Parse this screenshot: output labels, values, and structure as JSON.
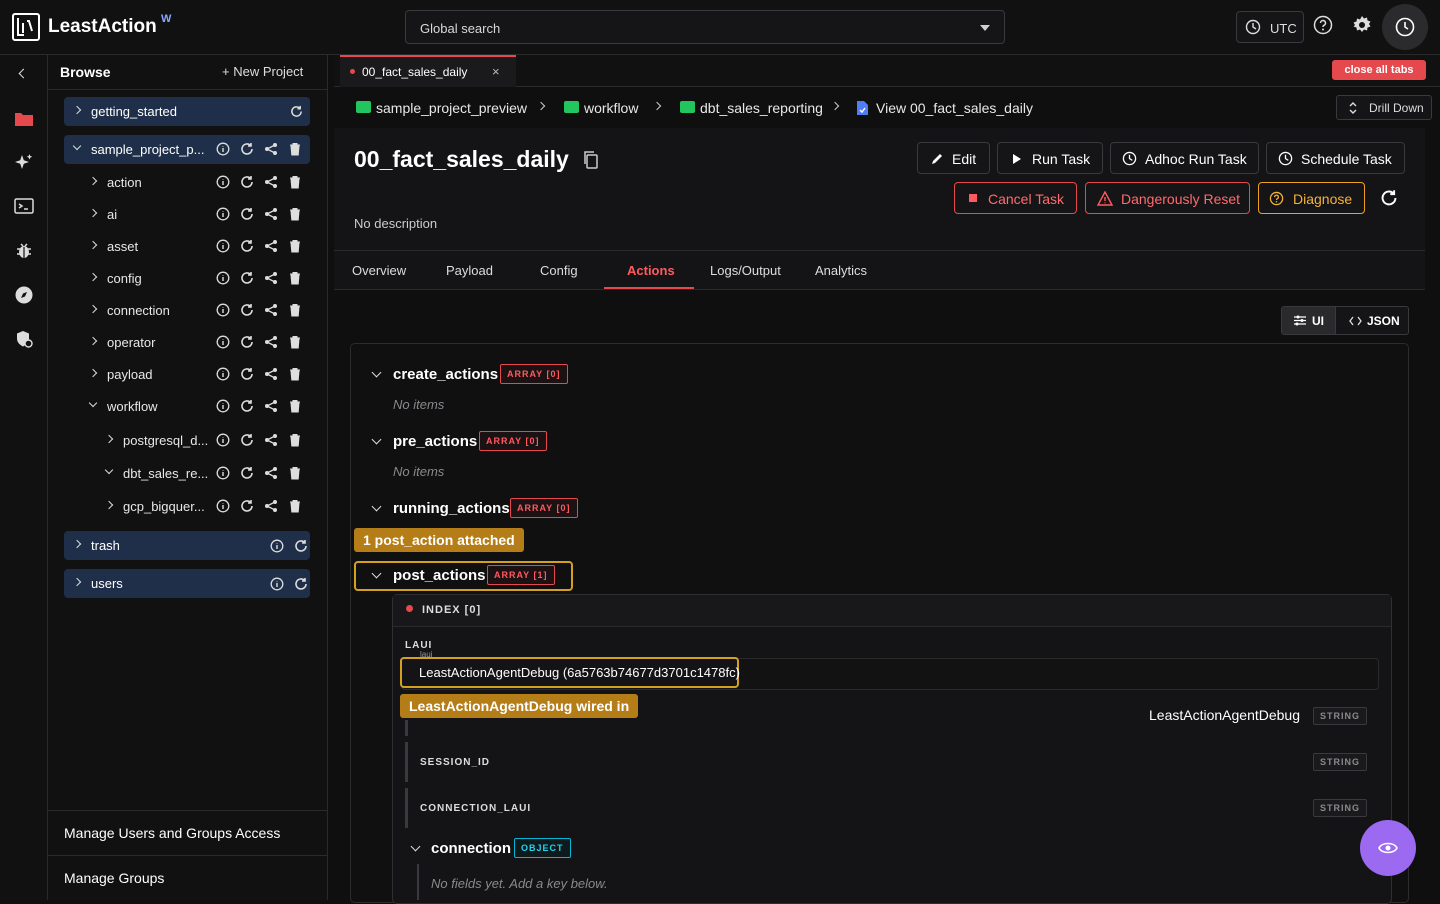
{
  "app": {
    "name": "LeastAction",
    "superscript": "W"
  },
  "topbar": {
    "search_placeholder": "Global search",
    "timezone": "UTC"
  },
  "sidebar": {
    "title": "Browse",
    "new_project": "+ New Project",
    "roots": [
      "getting_started",
      "sample_project_p...",
      "trash",
      "users"
    ],
    "children": [
      "action",
      "ai",
      "asset",
      "config",
      "connection",
      "operator",
      "payload",
      "workflow"
    ],
    "workflow_children": [
      "postgresql_d...",
      "dbt_sales_re...",
      "gcp_bigquer..."
    ],
    "manage_users": "Manage Users and Groups Access",
    "manage_groups": "Manage Groups"
  },
  "tabs": {
    "active": "00_fact_sales_daily",
    "close": "×",
    "close_all": "close all tabs"
  },
  "breadcrumb": [
    "sample_project_preview",
    "workflow",
    "dbt_sales_reporting",
    "View 00_fact_sales_daily"
  ],
  "drill_down": "Drill Down",
  "task": {
    "title": "00_fact_sales_daily",
    "description": "No description"
  },
  "buttons": {
    "edit": "Edit",
    "run": "Run Task",
    "adhoc": "Adhoc Run Task",
    "schedule": "Schedule Task",
    "cancel": "Cancel Task",
    "reset": "Dangerously Reset",
    "diagnose": "Diagnose"
  },
  "nav_tabs": [
    "Overview",
    "Payload",
    "Config",
    "Actions",
    "Logs/Output",
    "Analytics"
  ],
  "mode": {
    "ui": "UI",
    "json": "JSON"
  },
  "sections": [
    {
      "name": "create_actions",
      "badge": "ARRAY [0]",
      "empty": "No items"
    },
    {
      "name": "pre_actions",
      "badge": "ARRAY [0]",
      "empty": "No items"
    },
    {
      "name": "running_actions",
      "badge": "ARRAY [0]"
    },
    {
      "name": "post_actions",
      "badge": "ARRAY [1]"
    }
  ],
  "annotations": {
    "post_action": "1 post_action attached",
    "wired": "LeastActionAgentDebug wired in"
  },
  "post_item": {
    "index": "INDEX [0]",
    "laui_label": "LAUI",
    "laui_sub": "laui",
    "laui_value": "LeastActionAgentDebug (6a5763b74677d3701c1478fc)",
    "name_value": "LeastActionAgentDebug",
    "string_badge": "STRING",
    "session_label": "SESSION_ID",
    "connection_laui_label": "CONNECTION_LAUI",
    "connection": "connection",
    "object_badge": "OBJECT",
    "connection_empty": "No fields yet. Add a key below."
  },
  "colors": {
    "accent": "#e5484d",
    "folder": "#22c55e",
    "highlight": "#d4a020",
    "fab": "#9b6af0",
    "node": "#1f2f49"
  }
}
